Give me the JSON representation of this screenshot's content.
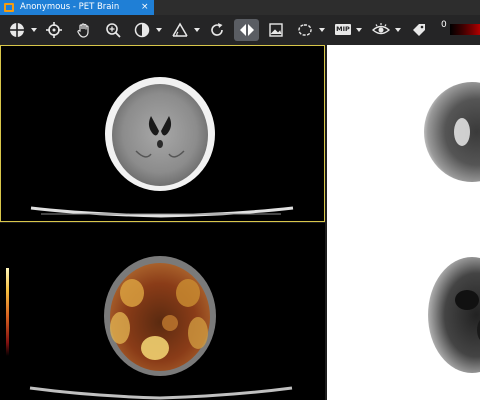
{
  "tab": {
    "title": "Anonymous - PET Brain",
    "close": "×"
  },
  "toolbar": {
    "items": [
      {
        "name": "layout-icon"
      },
      {
        "name": "crosshair-icon"
      },
      {
        "name": "pan-hand-icon"
      },
      {
        "name": "zoom-icon"
      },
      {
        "name": "contrast-icon"
      },
      {
        "name": "measure-angle-icon"
      },
      {
        "name": "rotate-icon"
      },
      {
        "name": "flip-horizontal-icon",
        "active": true
      },
      {
        "name": "image-icon"
      },
      {
        "name": "roi-shape-icon"
      },
      {
        "name": "mip-icon"
      },
      {
        "name": "eye-icon"
      },
      {
        "name": "tag-icon"
      }
    ],
    "mip_label": "MIP",
    "colormap_min": "0",
    "colormap_colors": [
      "#000000",
      "#7a0000",
      "#b30000"
    ]
  },
  "viewports": {
    "ct": {
      "active_border": "#d8c64a"
    },
    "fusion": {
      "colorbar": [
        "#fff7c0",
        "#d86020",
        "#000000"
      ]
    },
    "pet": {
      "background": "#ffffff"
    }
  },
  "colors": {
    "tab_active": "#1f7fd6",
    "toolbar_bg": "#252526"
  }
}
